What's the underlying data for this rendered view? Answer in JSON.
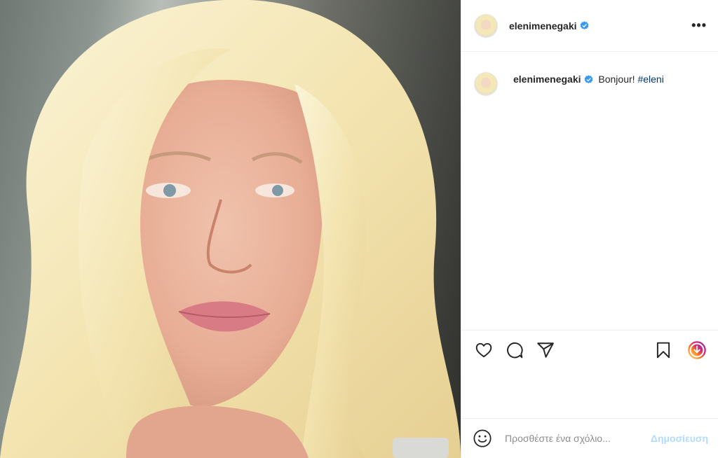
{
  "post": {
    "username": "elenimenegaki",
    "verified": true,
    "more_icon": "more-horizontal-icon",
    "caption": {
      "username": "elenimenegaki",
      "text": "Bonjour!",
      "hashtag": "#eleni"
    },
    "actions": {
      "like": "heart-icon",
      "comment": "comment-icon",
      "share": "share-icon",
      "save": "bookmark-icon",
      "story": "story-icon"
    },
    "comment_box": {
      "emoji_icon": "emoji-icon",
      "placeholder": "Προσθέστε ένα σχόλιο...",
      "post_label": "Δημοσίευση"
    }
  },
  "colors": {
    "verified": "#3897f0",
    "hashtag": "#00376b",
    "post_button_disabled": "#b3dbff"
  }
}
